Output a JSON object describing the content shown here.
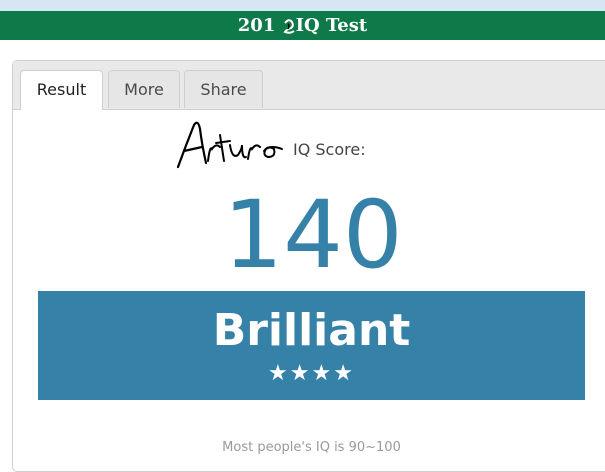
{
  "header": {
    "title_prefix": "201",
    "title_suffix": " IQ Test"
  },
  "tabs": [
    {
      "label": "Result",
      "active": true
    },
    {
      "label": "More",
      "active": false
    },
    {
      "label": "Share",
      "active": false
    }
  ],
  "result": {
    "signature_text": "Arturo",
    "score_label": "IQ Score:",
    "score": "140",
    "rating": "Brilliant",
    "stars": "★★★★",
    "footnote": "Most people's IQ is 90~100"
  },
  "colors": {
    "header_bg": "#0e7a4a",
    "accent": "#3581a8"
  }
}
